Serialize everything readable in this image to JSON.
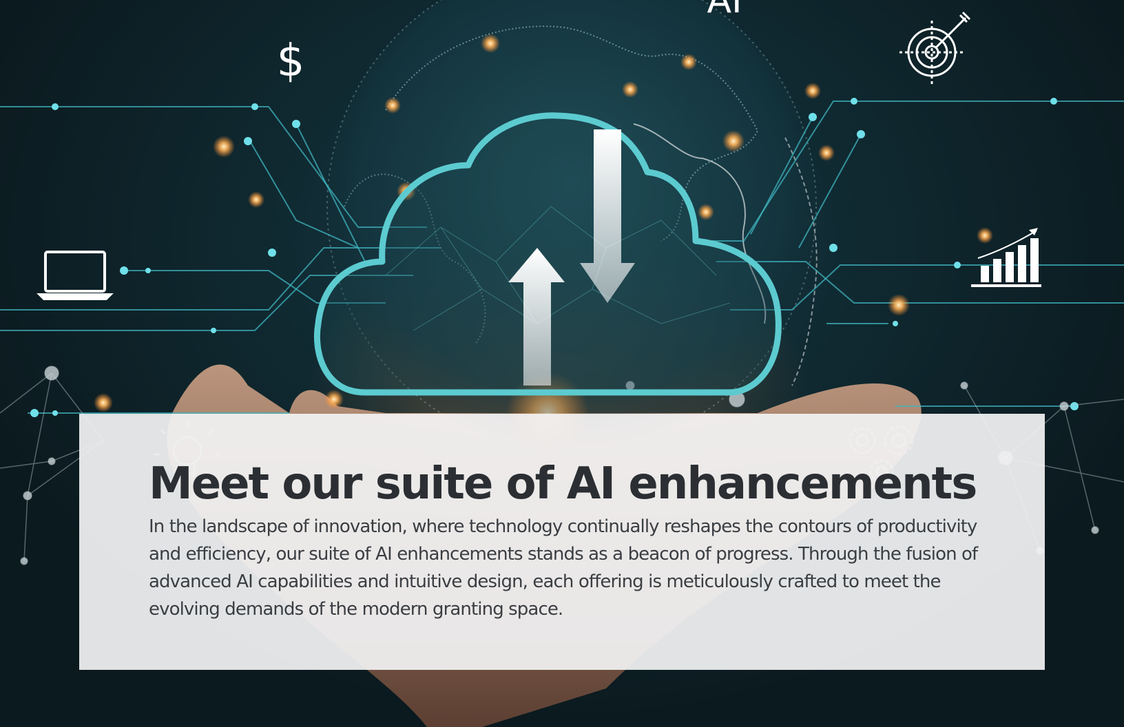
{
  "hero": {
    "ai_label": "AI",
    "dollar_label": "$",
    "icons": [
      "cloud-upload-download-icon",
      "globe-icon",
      "laptop-icon",
      "dollar-icon",
      "target-icon",
      "growth-chart-icon",
      "lightbulb-icon",
      "gears-icon"
    ],
    "colors": {
      "accent": "#4bc3c8",
      "glow": "#ffb35a",
      "background": "#102a32"
    }
  },
  "card": {
    "title": "Meet our suite of AI enhancements",
    "body": "In the landscape of innovation, where technology continually reshapes the contours of productivity and efficiency, our suite of AI enhancements stands as a beacon of progress. Through the fusion of advanced AI capabilities and intuitive design, each offering is meticulously crafted to meet the evolving demands of the modern granting space."
  }
}
